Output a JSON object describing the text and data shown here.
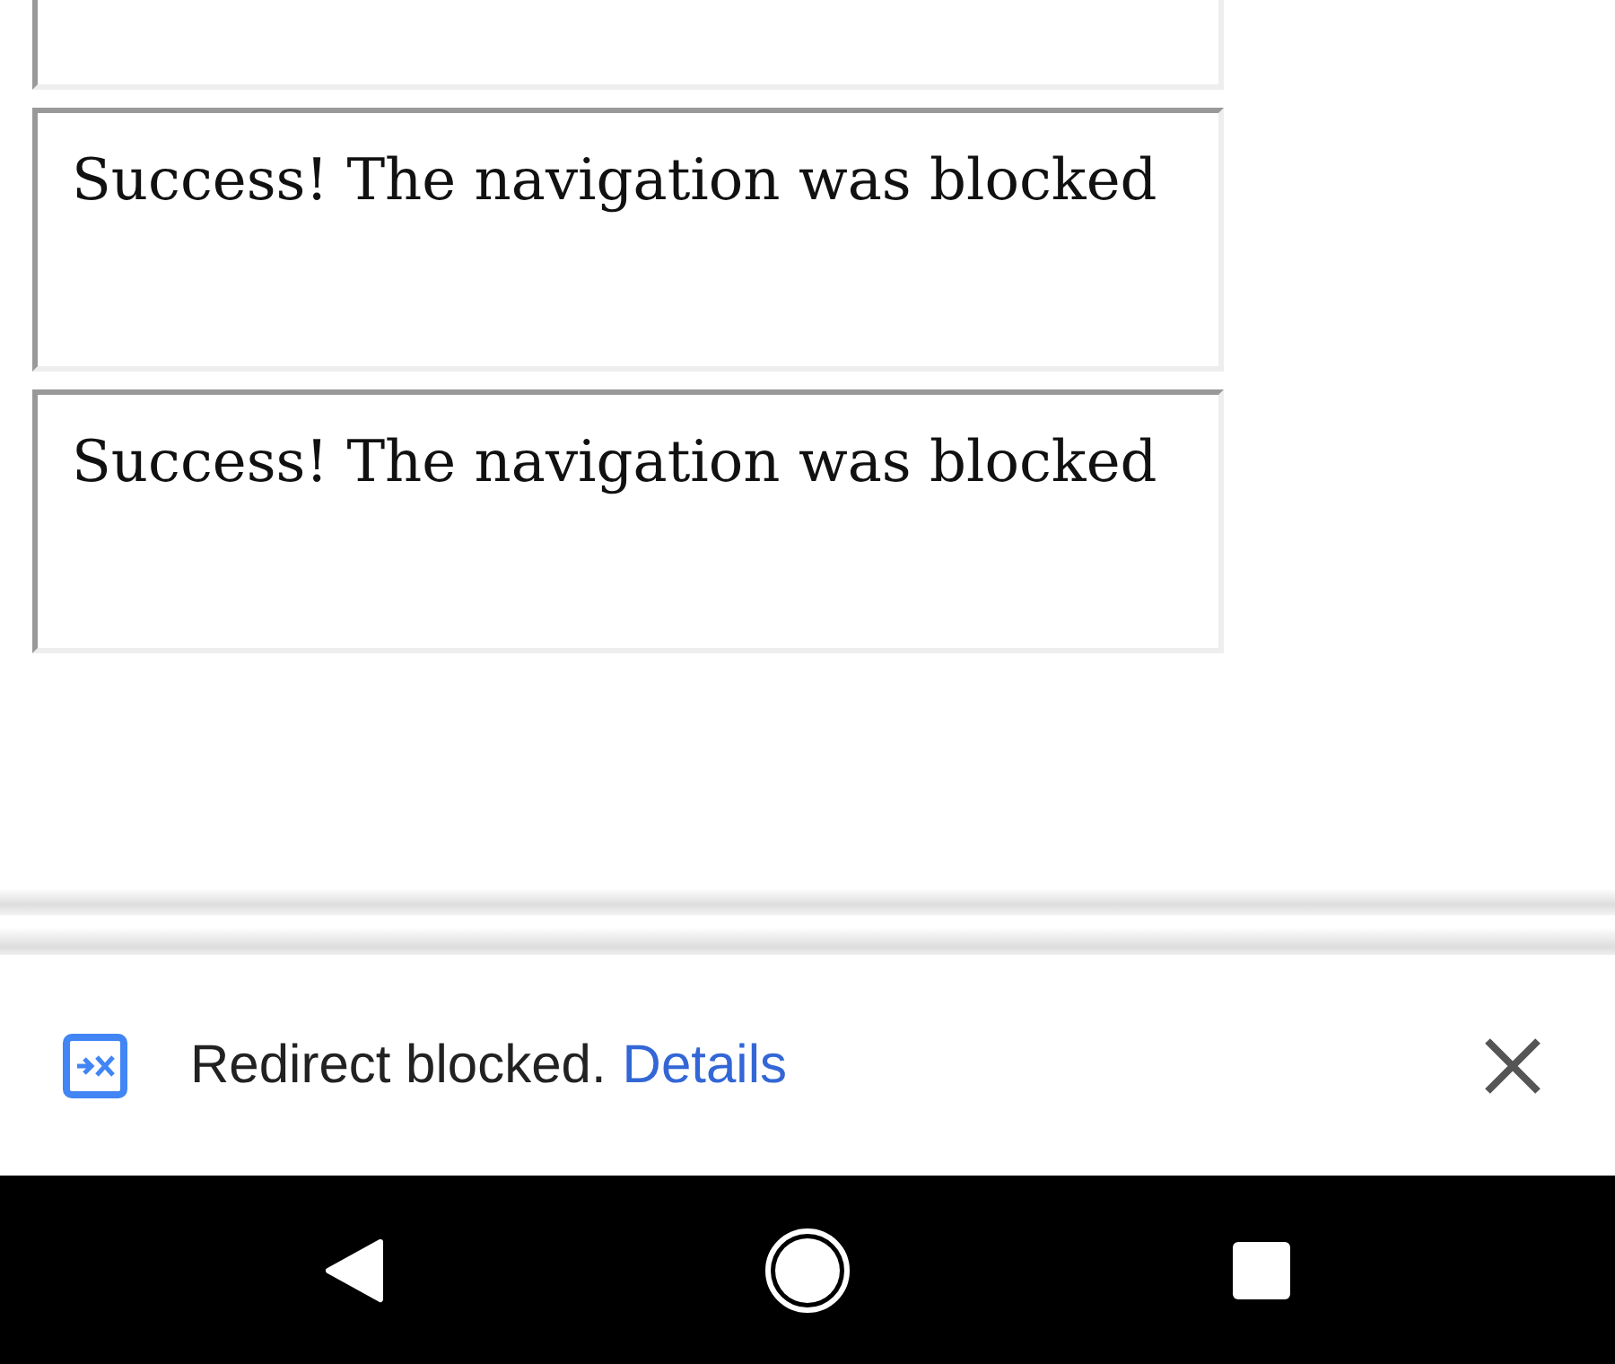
{
  "frames": [
    {
      "kind": "cut"
    },
    {
      "kind": "message",
      "text": "Success! The navigation was blocked"
    },
    {
      "kind": "message",
      "text": "Success! The navigation was blocked"
    }
  ],
  "infobar": {
    "message": "Redirect blocked.",
    "link": "Details"
  }
}
